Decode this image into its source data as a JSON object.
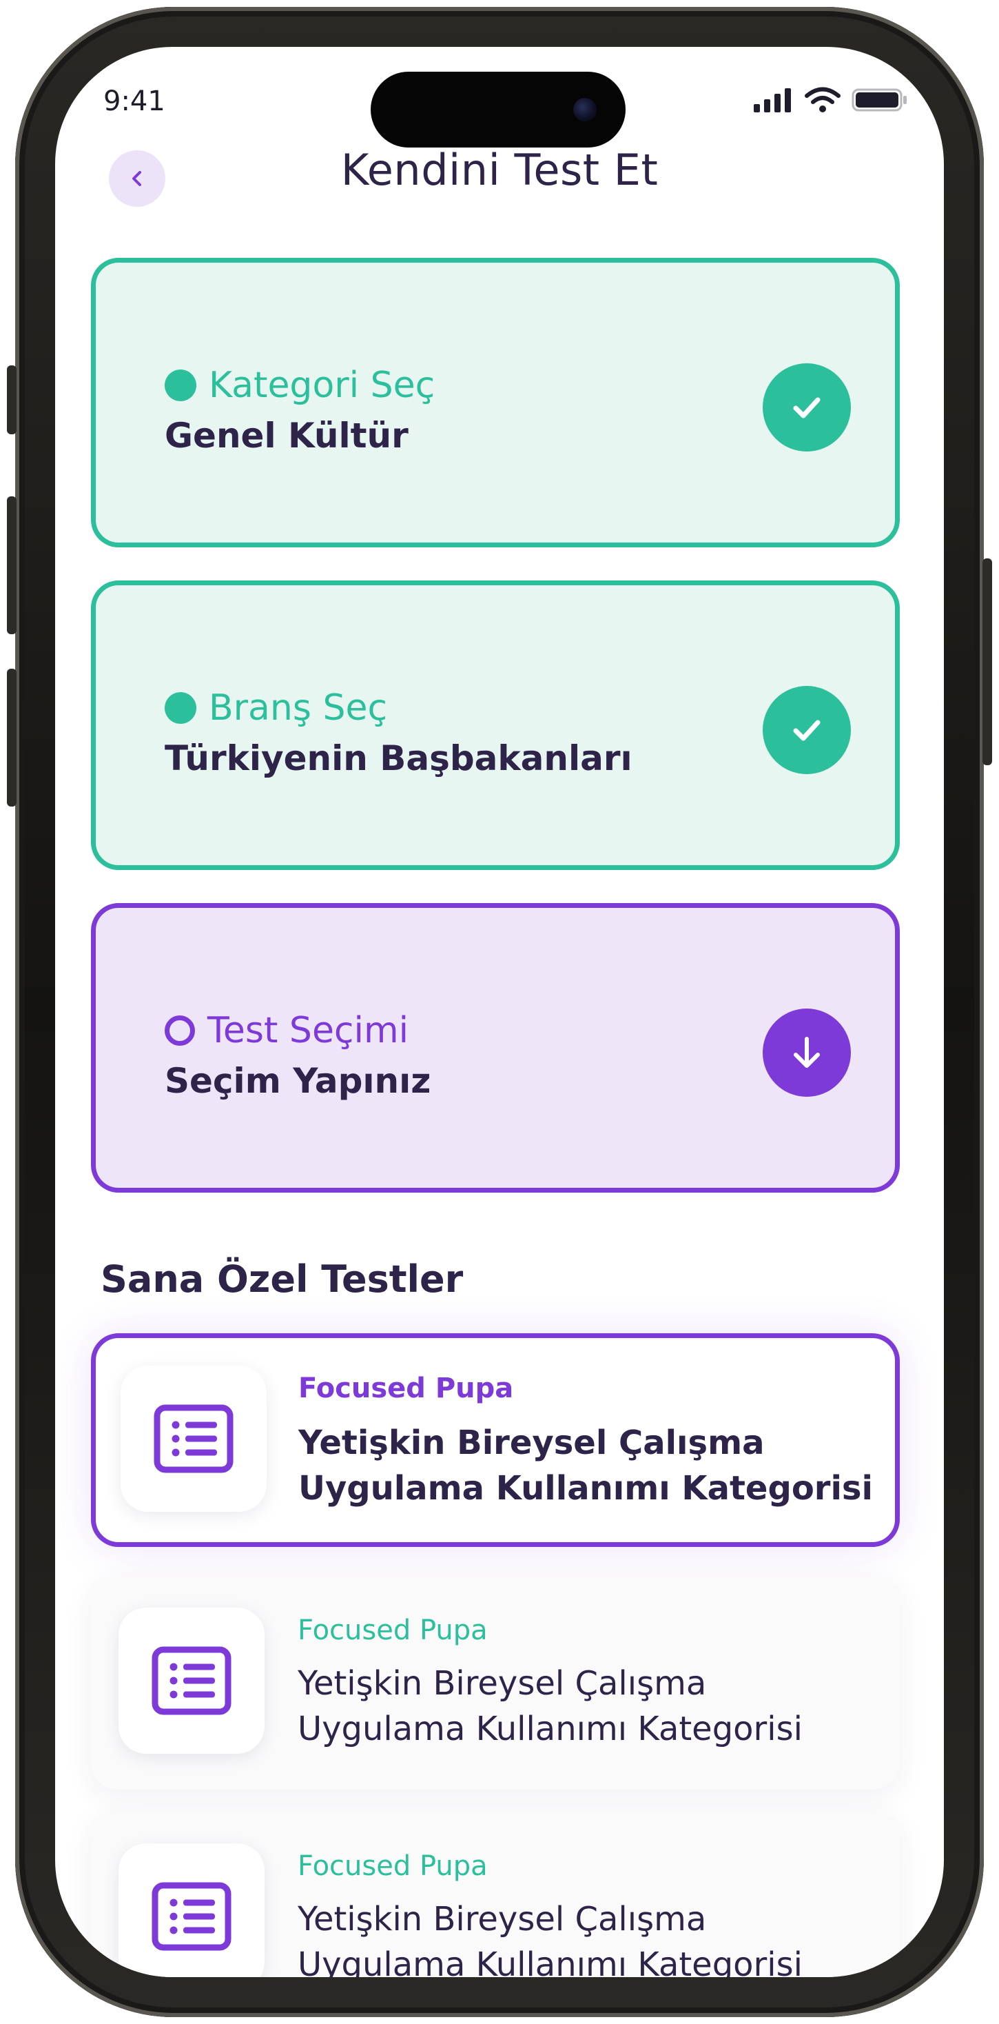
{
  "status_bar": {
    "time": "9:41"
  },
  "header": {
    "title": "Kendini Test Et"
  },
  "steps": [
    {
      "label": "Kategori Seç",
      "value": "Genel Kültür",
      "state": "done"
    },
    {
      "label": "Branş Seç",
      "value": "Türkiyenin Başbakanları",
      "state": "done"
    },
    {
      "label": "Test Seçimi",
      "value": "Seçim Yapınız",
      "state": "active"
    }
  ],
  "section": {
    "title": "Sana Özel Testler"
  },
  "tests": [
    {
      "tag": "Focused Pupa",
      "line1": "Yetişkin Bireysel Çalışma",
      "line2": "Uygulama Kullanımı Kategorisi"
    },
    {
      "tag": "Focused Pupa",
      "line1": "Yetişkin Bireysel Çalışma",
      "line2": "Uygulama Kullanımı Kategorisi"
    },
    {
      "tag": "Focused Pupa",
      "line1": "Yetişkin Bireysel Çalışma",
      "line2": "Uygulama Kullanımı Kategorisi"
    }
  ],
  "colors": {
    "accent_green": "#2bbf9b",
    "accent_purple": "#7d3ad8",
    "text_dark": "#2e2349"
  }
}
